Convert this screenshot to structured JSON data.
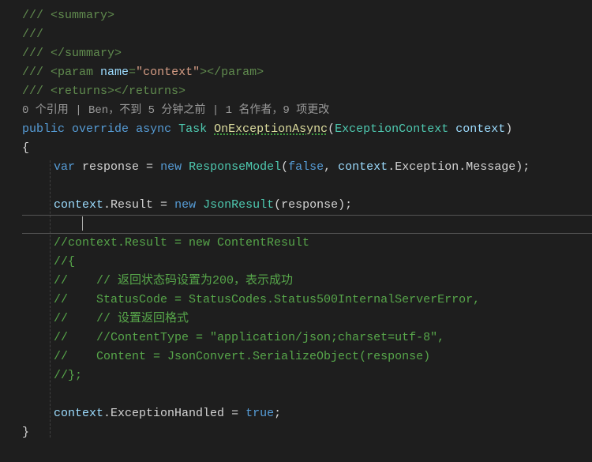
{
  "doc": {
    "line1": "/// <summary>",
    "line2": "/// ",
    "line3": "/// </summary>",
    "param_open": "/// <param ",
    "param_name_attr": "name",
    "param_eq": "=",
    "param_val": "\"context\"",
    "param_close": "></param>",
    "returns": "/// <returns></returns>"
  },
  "codelens": "0 个引用 | Ben，不到 5 分钟之前 | 1 名作者，9 项更改",
  "sig": {
    "k_public": "public",
    "k_override": "override",
    "k_async": "async",
    "t_task": "Task",
    "m_name": "OnExceptionAsync",
    "p_open": "(",
    "t_ctx": "ExceptionContext",
    "p_ctx": "context",
    "p_close": ")"
  },
  "brace_open": "{",
  "brace_close": "}",
  "body": {
    "l1_var": "var",
    "l1_resp": "response",
    "l1_eq": " = ",
    "l1_new": "new",
    "l1_type": "ResponseModel",
    "l1_open": "(",
    "l1_false": "false",
    "l1_comma": ", ",
    "l1_ctx": "context",
    "l1_dot1": ".",
    "l1_exc": "Exception",
    "l1_dot2": ".",
    "l1_msg": "Message",
    "l1_end": ");",
    "l2_ctx": "context",
    "l2_dot": ".",
    "l2_res": "Result",
    "l2_eq": " = ",
    "l2_new": "new",
    "l2_type": "JsonResult",
    "l2_open": "(",
    "l2_arg": "response",
    "l2_end": ");",
    "c1": "//context.Result = new ContentResult",
    "c2": "//{",
    "c3": "//    // 返回状态码设置为200，表示成功",
    "c4": "//    StatusCode = StatusCodes.Status500InternalServerError,",
    "c5": "//    // 设置返回格式",
    "c6": "//    //ContentType = \"application/json;charset=utf-8\",",
    "c7": "//    Content = JsonConvert.SerializeObject(response)",
    "c8": "//};",
    "l3_ctx": "context",
    "l3_dot": ".",
    "l3_hnd": "ExceptionHandled",
    "l3_eq": " = ",
    "l3_true": "true",
    "l3_end": ";"
  }
}
